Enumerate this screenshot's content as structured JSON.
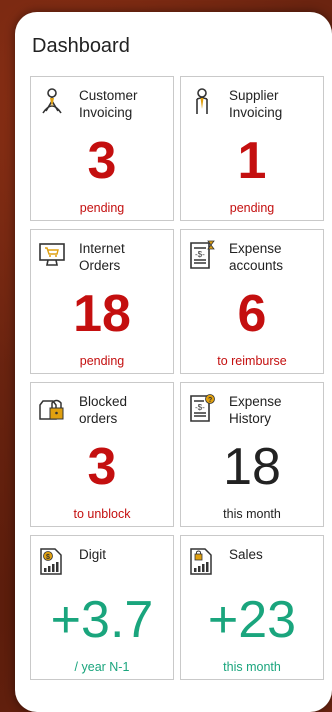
{
  "dashboard": {
    "title": "Dashboard",
    "cards": [
      {
        "label": "Customer\nInvoicing",
        "value": "3",
        "sub": "pending",
        "icon": "customer-person-icon",
        "style": "red"
      },
      {
        "label": "Supplier\nInvoicing",
        "value": "1",
        "sub": "pending",
        "icon": "supplier-person-icon",
        "style": "red"
      },
      {
        "label": "Internet\nOrders",
        "value": "18",
        "sub": "pending",
        "icon": "computer-cart-icon",
        "style": "red"
      },
      {
        "label": "Expense\naccounts",
        "value": "6",
        "sub": "to reimburse",
        "icon": "expense-receipt-icon",
        "style": "red"
      },
      {
        "label": "Blocked\norders",
        "value": "3",
        "sub": "to unblock",
        "icon": "padlock-icon",
        "style": "red"
      },
      {
        "label": "Expense\nHistory",
        "value": "18",
        "sub": "this month",
        "icon": "expense-history-icon",
        "style": "dark"
      },
      {
        "label": "Digit",
        "value": "+3.7",
        "sub": "/ year N-1",
        "icon": "digit-chart-icon",
        "style": "green"
      },
      {
        "label": "Sales",
        "value": "+23",
        "sub": "this month",
        "icon": "sales-chart-icon",
        "style": "green"
      }
    ]
  },
  "colors": {
    "red": "#c40f0f",
    "green": "#1aa57d",
    "dark": "#222222",
    "icon_gold": "#e0a010"
  }
}
